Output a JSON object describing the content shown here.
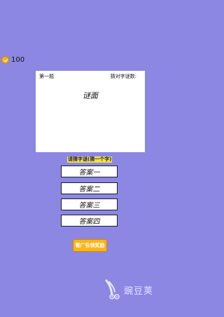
{
  "coins": {
    "icon": "coin-icon",
    "count": "100"
  },
  "panel": {
    "question_label": "第一题",
    "solved_label": "猜对字谜数:",
    "riddle": "谜面"
  },
  "hint": "请猜字谜(猜一个字)",
  "answers": [
    "答案一",
    "答案二",
    "答案三",
    "答案四"
  ],
  "ad_button": "看广告领奖励",
  "watermark": {
    "icon": "wandoujia-logo",
    "text": "豌豆荚"
  },
  "colors": {
    "background": "#8b87e3",
    "gold": "#f9b617",
    "hint_bg": "#f2e23a"
  }
}
